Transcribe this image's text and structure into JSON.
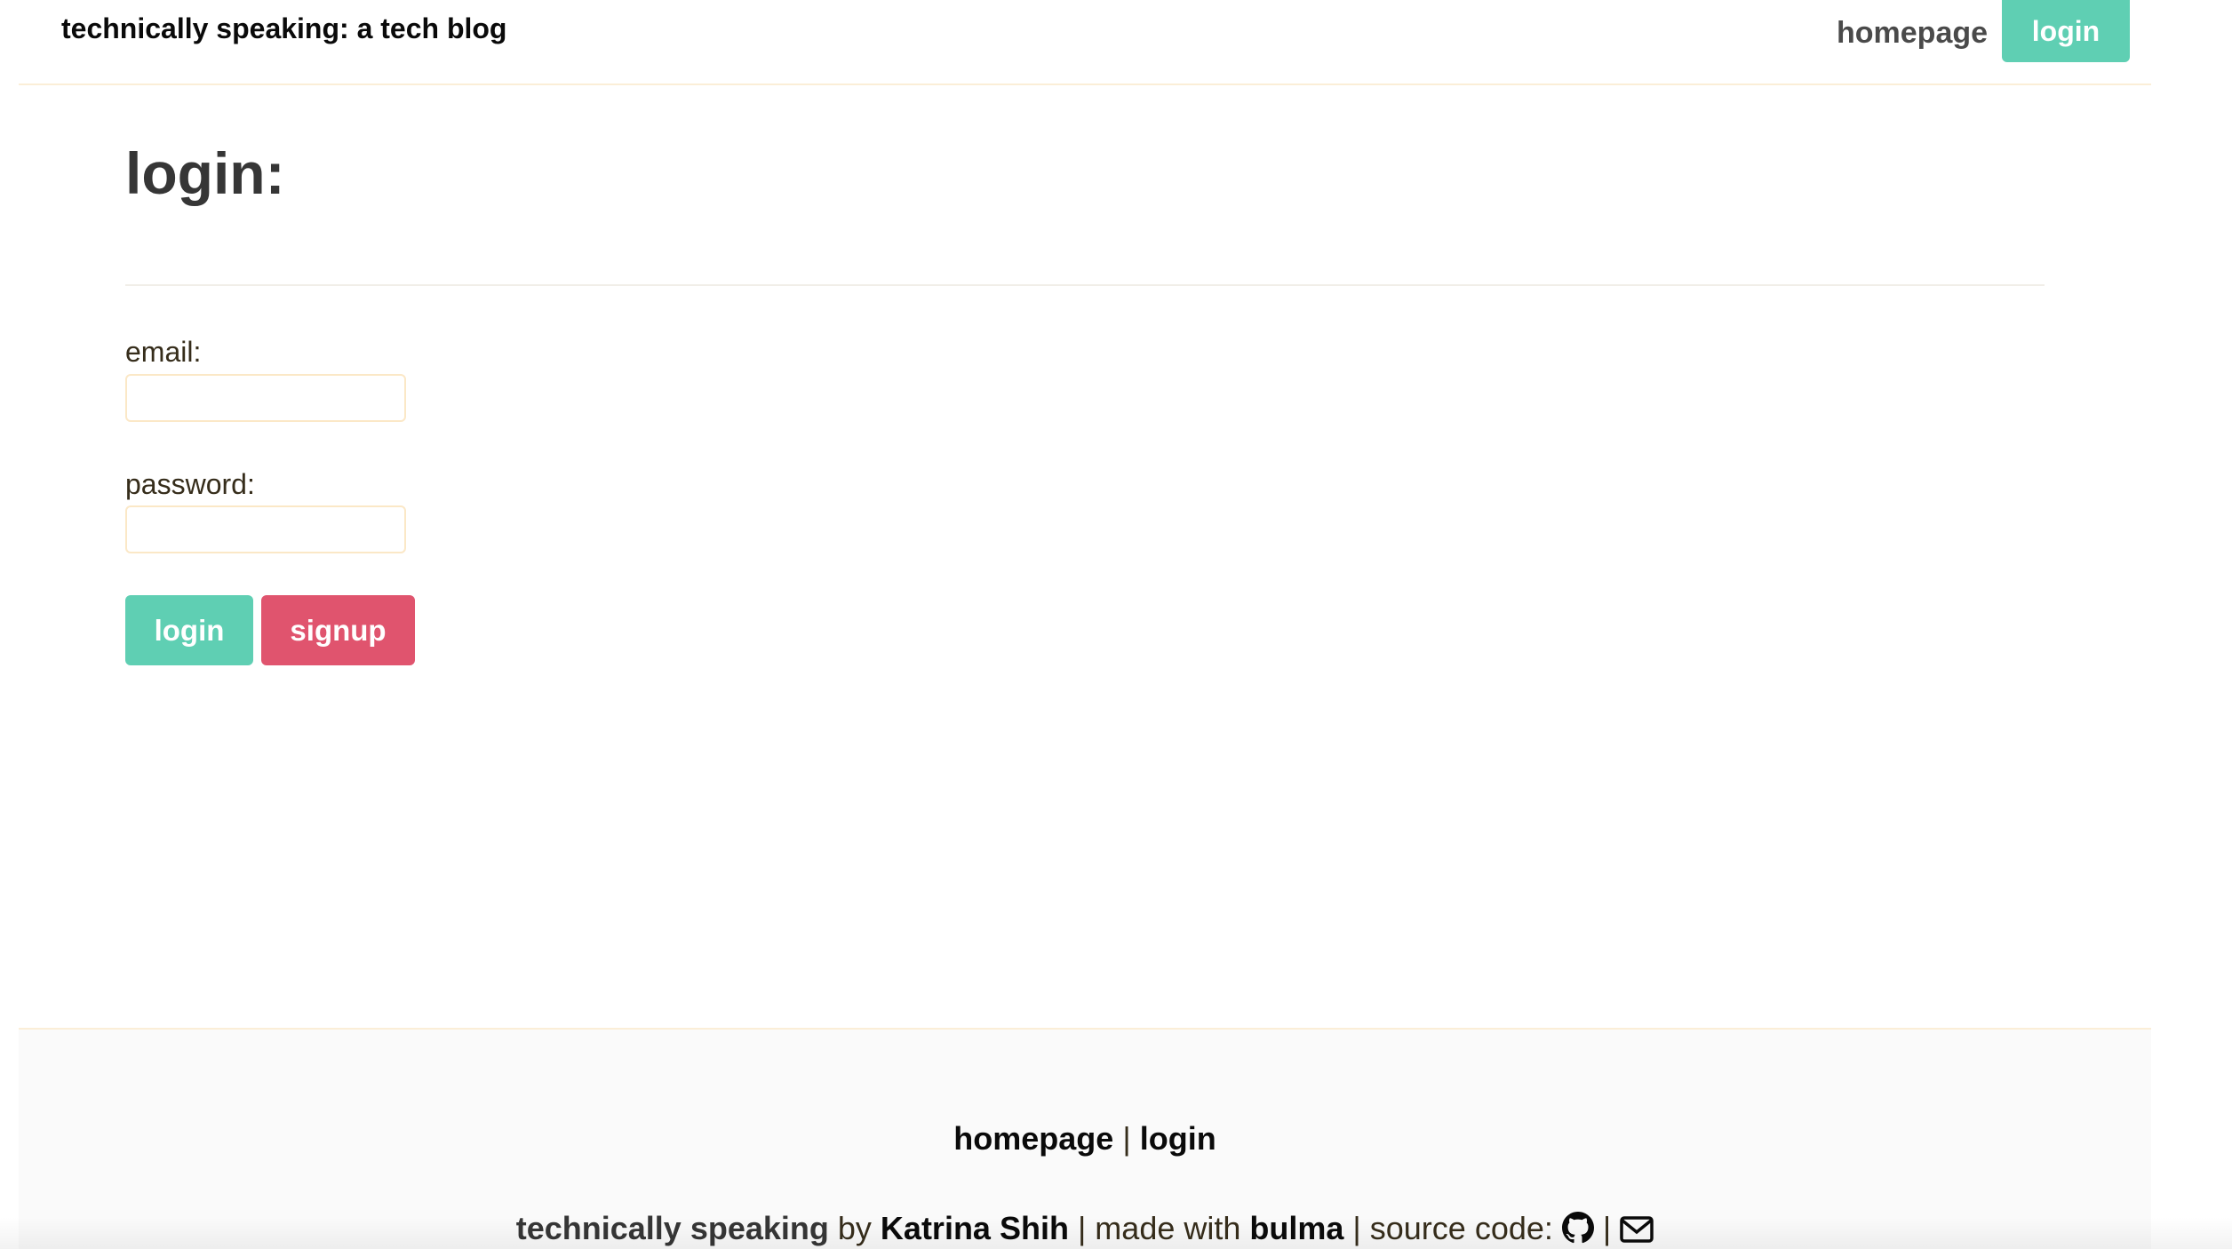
{
  "navbar": {
    "brand": "technically speaking: a tech blog",
    "homepage_link": "homepage",
    "login_button": "login"
  },
  "main": {
    "title": "login:",
    "email_label": "email:",
    "email_value": "",
    "password_label": "password:",
    "password_value": "",
    "login_button": "login",
    "signup_button": "signup"
  },
  "footer": {
    "homepage_link": "homepage",
    "separator": "|",
    "login_link": "login",
    "site_name": "technically speaking",
    "by_text": " by ",
    "author": "Katrina Shih",
    "made_with_text": " | made with ",
    "framework": "bulma",
    "source_code_text": " | source code: ",
    "icon_separator": " | ",
    "github_icon": "github-icon",
    "email_icon": "envelope-icon"
  },
  "colors": {
    "primary": "#5fcfb3",
    "danger": "#e0546e",
    "text": "#363636",
    "footer_bg": "#fafafa",
    "border": "#fbeed7"
  }
}
